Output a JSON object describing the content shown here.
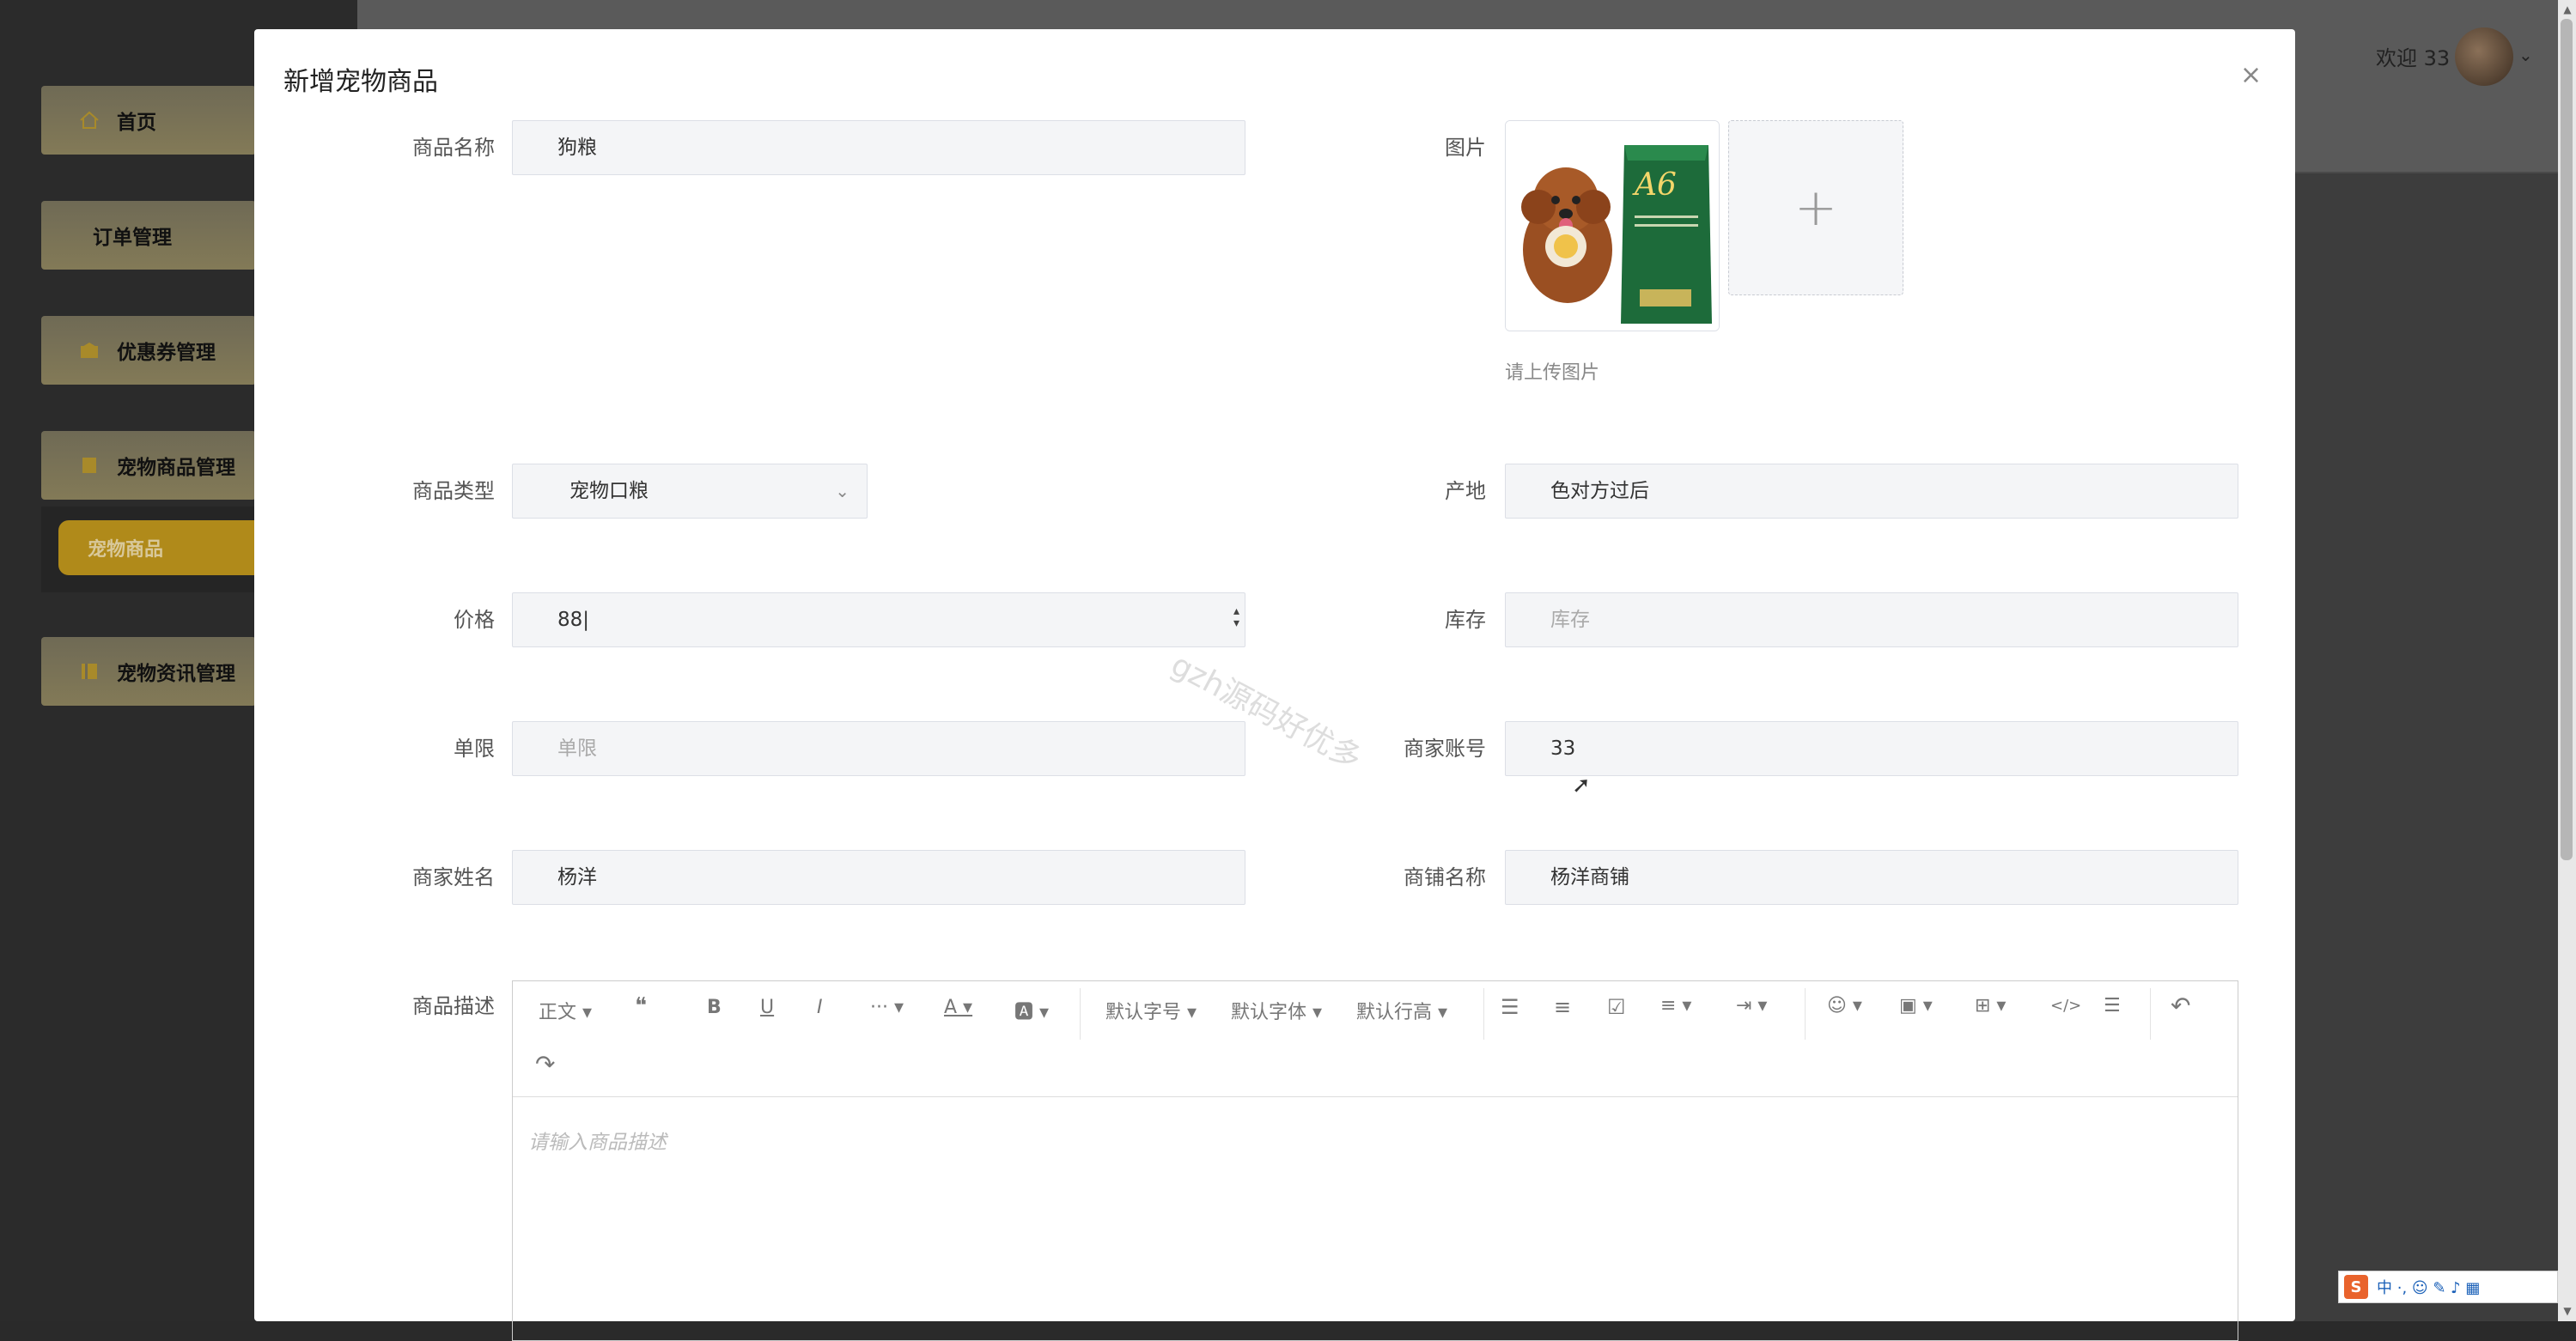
{
  "header": {
    "welcome": "欢迎 33",
    "caret": "⌄"
  },
  "sidebar": {
    "items": [
      {
        "label": "首页",
        "icon": "home-icon"
      },
      {
        "label": "订单管理",
        "icon": ""
      },
      {
        "label": "优惠券管理",
        "icon": "coupon-icon"
      },
      {
        "label": "宠物商品管理",
        "icon": "goods-icon"
      },
      {
        "label": "宠物资讯管理",
        "icon": "news-icon"
      }
    ],
    "active_sub": "宠物商品"
  },
  "dialog": {
    "title": "新增宠物商品",
    "close": "×",
    "fields": {
      "name": {
        "label": "商品名称",
        "value": "狗粮"
      },
      "image": {
        "label": "图片",
        "add": "+",
        "hint": "请上传图片"
      },
      "type": {
        "label": "商品类型",
        "value": "宠物口粮",
        "arrow": "⌄"
      },
      "origin": {
        "label": "产地",
        "value": "色对方过后"
      },
      "price": {
        "label": "价格",
        "value": "88|",
        "spin": "▲▼"
      },
      "stock": {
        "label": "库存",
        "placeholder": "库存"
      },
      "limit": {
        "label": "单限",
        "placeholder": "单限"
      },
      "merchant_account": {
        "label": "商家账号",
        "value": "33"
      },
      "merchant_name": {
        "label": "商家姓名",
        "value": "杨洋"
      },
      "shop_name": {
        "label": "商铺名称",
        "value": "杨洋商铺"
      },
      "description": {
        "label": "商品描述",
        "placeholder": "请输入商品描述"
      }
    },
    "editor_toolbar": {
      "paragraph": "正文 ▾",
      "quote": "❝",
      "bold": "B",
      "underline": "U",
      "italic": "I",
      "more": "··· ▾",
      "font_color": "A ▾",
      "bg_color": "🅰 ▾",
      "font_size": "默认字号 ▾",
      "font_family": "默认字体 ▾",
      "line_height": "默认行高 ▾",
      "bullet_list": "☰",
      "numbered_list": "≡",
      "todo": "☑",
      "align": "≡ ▾",
      "indent": "⇥ ▾",
      "emoji": "☺ ▾",
      "image": "▣ ▾",
      "table": "⊞ ▾",
      "code": "</>",
      "divider": "☰",
      "undo": "↶",
      "redo": "↷"
    }
  },
  "watermark": "gzh源码好优多",
  "ime": {
    "logo": "S",
    "label": "中 ·, ☺ ✎ ♪ ▦"
  }
}
